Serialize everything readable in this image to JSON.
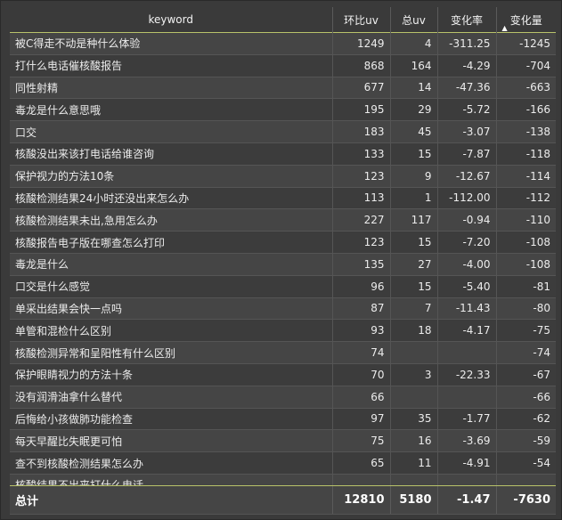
{
  "columns": {
    "keyword": "keyword",
    "huanbi_uv": "环比uv",
    "total_uv": "总uv",
    "change_rate": "变化率",
    "change_amount": "变化量"
  },
  "sort": {
    "column": "change_amount",
    "direction": "asc",
    "icon": "sort-up-triangle"
  },
  "rows": [
    {
      "keyword": "被C得走不动是种什么体验",
      "huanbi_uv": "1249",
      "total_uv": "4",
      "change_rate": "-311.25",
      "change_amount": "-1245"
    },
    {
      "keyword": "打什么电话催核酸报告",
      "huanbi_uv": "868",
      "total_uv": "164",
      "change_rate": "-4.29",
      "change_amount": "-704"
    },
    {
      "keyword": "同性射精",
      "huanbi_uv": "677",
      "total_uv": "14",
      "change_rate": "-47.36",
      "change_amount": "-663"
    },
    {
      "keyword": "毒龙是什么意思哦",
      "huanbi_uv": "195",
      "total_uv": "29",
      "change_rate": "-5.72",
      "change_amount": "-166"
    },
    {
      "keyword": "口交",
      "huanbi_uv": "183",
      "total_uv": "45",
      "change_rate": "-3.07",
      "change_amount": "-138"
    },
    {
      "keyword": "核酸没出来该打电话给谁咨询",
      "huanbi_uv": "133",
      "total_uv": "15",
      "change_rate": "-7.87",
      "change_amount": "-118"
    },
    {
      "keyword": "保护视力的方法10条",
      "huanbi_uv": "123",
      "total_uv": "9",
      "change_rate": "-12.67",
      "change_amount": "-114"
    },
    {
      "keyword": "核酸检测结果24小时还没出来怎么办",
      "huanbi_uv": "113",
      "total_uv": "1",
      "change_rate": "-112.00",
      "change_amount": "-112"
    },
    {
      "keyword": "核酸检测结果未出,急用怎么办",
      "huanbi_uv": "227",
      "total_uv": "117",
      "change_rate": "-0.94",
      "change_amount": "-110"
    },
    {
      "keyword": "核酸报告电子版在哪查怎么打印",
      "huanbi_uv": "123",
      "total_uv": "15",
      "change_rate": "-7.20",
      "change_amount": "-108"
    },
    {
      "keyword": "毒龙是什么",
      "huanbi_uv": "135",
      "total_uv": "27",
      "change_rate": "-4.00",
      "change_amount": "-108"
    },
    {
      "keyword": "口交是什么感觉",
      "huanbi_uv": "96",
      "total_uv": "15",
      "change_rate": "-5.40",
      "change_amount": "-81"
    },
    {
      "keyword": "单采出结果会快一点吗",
      "huanbi_uv": "87",
      "total_uv": "7",
      "change_rate": "-11.43",
      "change_amount": "-80"
    },
    {
      "keyword": "单管和混检什么区别",
      "huanbi_uv": "93",
      "total_uv": "18",
      "change_rate": "-4.17",
      "change_amount": "-75"
    },
    {
      "keyword": "核酸检测异常和呈阳性有什么区别",
      "huanbi_uv": "74",
      "total_uv": "",
      "change_rate": "",
      "change_amount": "-74"
    },
    {
      "keyword": "保护眼睛视力的方法十条",
      "huanbi_uv": "70",
      "total_uv": "3",
      "change_rate": "-22.33",
      "change_amount": "-67"
    },
    {
      "keyword": "没有润滑油拿什么替代",
      "huanbi_uv": "66",
      "total_uv": "",
      "change_rate": "",
      "change_amount": "-66"
    },
    {
      "keyword": "后悔给小孩做肺功能检查",
      "huanbi_uv": "97",
      "total_uv": "35",
      "change_rate": "-1.77",
      "change_amount": "-62"
    },
    {
      "keyword": "每天早醒比失眠更可怕",
      "huanbi_uv": "75",
      "total_uv": "16",
      "change_rate": "-3.69",
      "change_amount": "-59"
    },
    {
      "keyword": "查不到核酸检测结果怎么办",
      "huanbi_uv": "65",
      "total_uv": "11",
      "change_rate": "-4.91",
      "change_amount": "-54"
    },
    {
      "keyword": "核酸结果不出来打什么电话",
      "huanbi_uv": "",
      "total_uv": "",
      "change_rate": "",
      "change_amount": ""
    }
  ],
  "totals": {
    "label": "总计",
    "huanbi_uv": "12810",
    "total_uv": "5180",
    "change_rate": "-1.47",
    "change_amount": "-7630"
  }
}
